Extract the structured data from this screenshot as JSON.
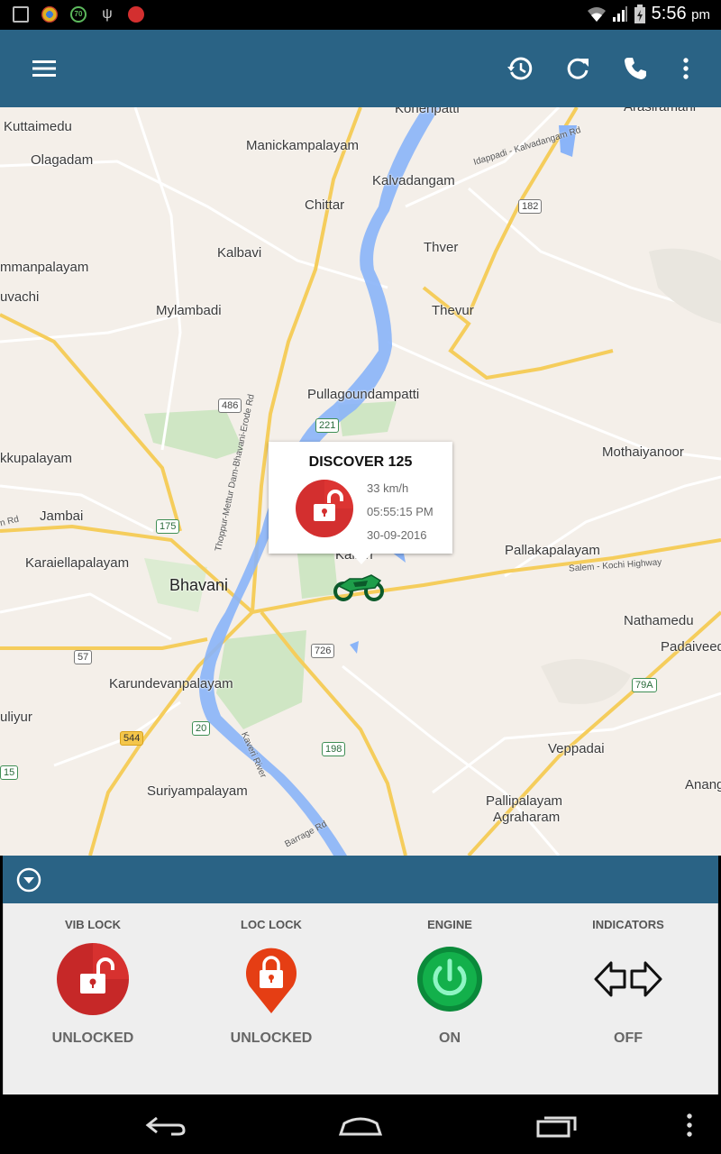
{
  "status_bar": {
    "left_icons": [
      "gallery-icon",
      "chrome-icon",
      "badge-70-icon",
      "usb-icon",
      "notification-red-icon"
    ],
    "badge_text": "70",
    "time": "5:56",
    "ampm": "pm"
  },
  "toolbar": {
    "icons": [
      "menu-icon",
      "history-icon",
      "refresh-icon",
      "phone-icon",
      "more-vert-icon"
    ],
    "color": "#2a6385"
  },
  "map": {
    "places": [
      {
        "name": "Konenpatti"
      },
      {
        "name": "Arasiramani"
      },
      {
        "name": "Kuttaimedu"
      },
      {
        "name": "Manickampalayam"
      },
      {
        "name": "Olagadam"
      },
      {
        "name": "Kalvadangam"
      },
      {
        "name": "Chittar"
      },
      {
        "name": "Kalbavi"
      },
      {
        "name": "mmanpalayam"
      },
      {
        "name": "Thver"
      },
      {
        "name": "uvachi"
      },
      {
        "name": "Mylambadi"
      },
      {
        "name": "Thevur"
      },
      {
        "name": "Pullagoundampatti"
      },
      {
        "name": "kkupalayam"
      },
      {
        "name": "Mothaiyanoor"
      },
      {
        "name": "Jambai"
      },
      {
        "name": "Karaiellapalayam"
      },
      {
        "name": "Bhavani"
      },
      {
        "name": "Kalleri"
      },
      {
        "name": "Pallakapalayam"
      },
      {
        "name": "Nathamedu"
      },
      {
        "name": "Padaiveedu"
      },
      {
        "name": "Karundevanpalayam"
      },
      {
        "name": "uliyur"
      },
      {
        "name": "Veppadai"
      },
      {
        "name": "Anangur"
      },
      {
        "name": "Suriyampalayam"
      },
      {
        "name": "Pallipalayam"
      },
      {
        "name": "Agraharam"
      }
    ],
    "shields": [
      "182",
      "486",
      "221",
      "175",
      "57",
      "726",
      "79A",
      "544",
      "20",
      "198",
      "15"
    ],
    "road_labels": [
      "Idappadi - Kalvadangam Rd",
      "Thoppur-Mettur Dam-Bhavani-Erode Rd",
      "Salem - Kochi Highway",
      "Kaveri River",
      "Barrage Rd",
      "n Rd"
    ]
  },
  "popup": {
    "title": "DISCOVER 125",
    "speed": "33 km/h",
    "time": "05:55:15 PM",
    "date": "30-09-2016",
    "lock_color": "#d32f2f"
  },
  "panel": {
    "collapse_icon": "chevron-down-circle-icon",
    "controls": [
      {
        "label": "VIB LOCK",
        "state": "UNLOCKED",
        "icon": "vib-lock-icon"
      },
      {
        "label": "LOC LOCK",
        "state": "UNLOCKED",
        "icon": "loc-lock-icon"
      },
      {
        "label": "ENGINE",
        "state": "ON",
        "icon": "engine-power-icon"
      },
      {
        "label": "INDICATORS",
        "state": "OFF",
        "icon": "indicators-icon"
      }
    ]
  },
  "nav_bar": {
    "icons": [
      "back-icon",
      "home-icon",
      "recents-icon",
      "overflow-icon"
    ]
  }
}
